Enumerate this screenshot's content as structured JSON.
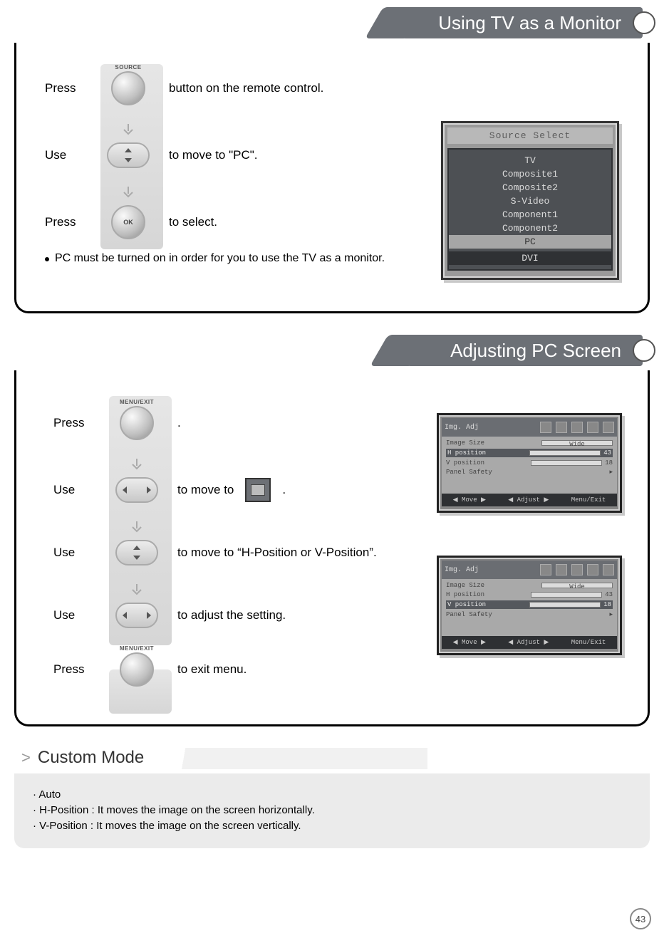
{
  "header1": "Using TV as a Monitor",
  "header2": "Adjusting PC Screen",
  "section1": {
    "row1_label": "Press",
    "row1_after": "button on the remote control.",
    "btn1_label": "SOURCE",
    "row2_label": "Use",
    "row2_after": "to move to  \"PC\".",
    "row3_label": "Press",
    "row3_after": "to select.",
    "btn3_label": "OK",
    "note": "PC must be turned on in order for you to use the TV as a monitor."
  },
  "osd_source": {
    "title": "Source Select",
    "items": [
      "TV",
      "Composite1",
      "Composite2",
      "S-Video",
      "Component1",
      "Component2",
      "PC",
      "DVI"
    ],
    "selected": "PC"
  },
  "section2": {
    "row1_label": "Press",
    "row1_after": ".",
    "btn1_label": "MENU/EXIT",
    "row2_label": "Use",
    "row2_after_a": "to move to",
    "row2_after_b": ".",
    "row3_label": "Use",
    "row3_after": "to move to “H-Position or V-Position”.",
    "row4_label": "Use",
    "row4_after": "to adjust the setting.",
    "row5_label": "Press",
    "row5_after": "to exit menu.",
    "btn5_label": "MENU/EXIT"
  },
  "osd_img": {
    "title": "Img. Adj",
    "lines1": [
      "Image Size",
      "H position",
      "V position",
      "Panel Safety"
    ],
    "sel1": "H position",
    "sel2": "V position",
    "val_wide": "Wide",
    "val1": "43",
    "val2": "18",
    "footer": [
      "Move",
      "Adjust",
      "Menu/Exit"
    ]
  },
  "custom": {
    "title": "Custom Mode",
    "l1": "Auto",
    "l2": "H-Position : It moves the image on the screen horizontally.",
    "l3": "V-Position : It moves the image on the screen vertically."
  },
  "page": "43"
}
